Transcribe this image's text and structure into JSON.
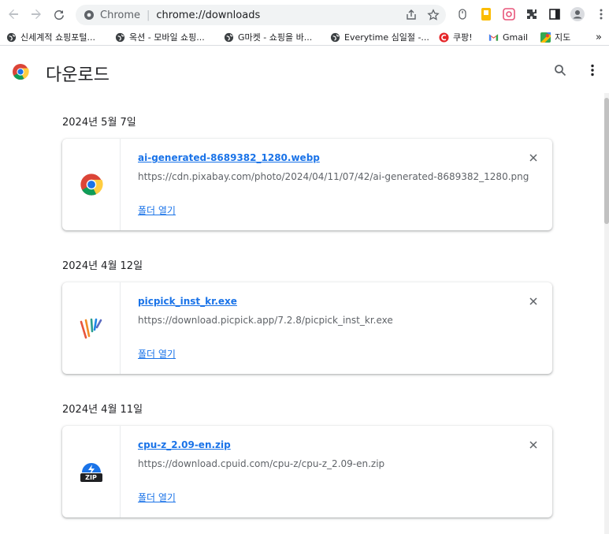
{
  "toolbar": {
    "site_name": "Chrome",
    "url": "chrome://downloads"
  },
  "bookmarks": [
    {
      "label": "신세계적 쇼핑포털...",
      "icon": "globe-icon"
    },
    {
      "label": "옥션 - 모바일 쇼핑...",
      "icon": "globe-icon"
    },
    {
      "label": "G마켓 - 쇼핑을 바...",
      "icon": "globe-icon"
    },
    {
      "label": "Everytime 심일절 -...",
      "icon": "globe-icon"
    },
    {
      "label": "쿠팡!",
      "icon": "coupang-icon"
    },
    {
      "label": "Gmail",
      "icon": "gmail-icon"
    },
    {
      "label": "지도",
      "icon": "maps-icon"
    }
  ],
  "bookmarks_overflow": "»",
  "page": {
    "title": "다운로드"
  },
  "downloads": [
    {
      "date": "2024년 5월 7일",
      "filename": "ai-generated-8689382_1280.webp",
      "source": "https://cdn.pixabay.com/photo/2024/04/11/07/42/ai-generated-8689382_1280.png",
      "action": "폴더 열기",
      "icon": "chrome-file-icon"
    },
    {
      "date": "2024년 4월 12일",
      "filename": "picpick_inst_kr.exe",
      "source": "https://download.picpick.app/7.2.8/picpick_inst_kr.exe",
      "action": "폴더 열기",
      "icon": "picpick-icon"
    },
    {
      "date": "2024년 4월 11일",
      "filename": "cpu-z_2.09-en.zip",
      "source": "https://download.cpuid.com/cpu-z/cpu-z_2.09-en.zip",
      "action": "폴더 열기",
      "icon": "zip-icon",
      "icon_text": "ZIP"
    }
  ],
  "colors": {
    "link": "#1a73e8",
    "text": "#202124",
    "secondary": "#5f6368"
  }
}
